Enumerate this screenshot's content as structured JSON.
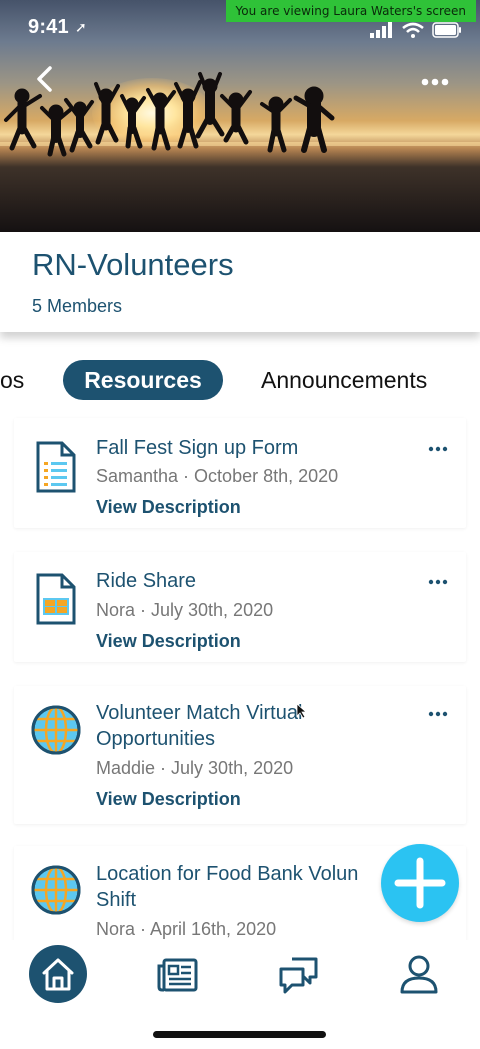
{
  "status_bar": {
    "time": "9:41",
    "share_banner": "You are viewing Laura Waters's screen"
  },
  "header": {
    "back_icon": "chevron-left-icon",
    "more_icon": "more-horizontal-icon"
  },
  "group": {
    "title": "RN-Volunteers",
    "members": "5 Members"
  },
  "tabs": {
    "left_partial": "os",
    "active": "Resources",
    "right": "Announcements"
  },
  "resources": [
    {
      "title": "Fall Fest Sign up Form",
      "meta": "Samantha · October 8th, 2020",
      "link": "View Description",
      "icon": "document-list-icon"
    },
    {
      "title": "Ride Share",
      "meta": "Nora · July 30th, 2020",
      "link": "View Description",
      "icon": "spreadsheet-icon"
    },
    {
      "title": "Volunteer Match Virtual Opportunities",
      "meta": "Maddie · July 30th, 2020",
      "link": "View Description",
      "icon": "globe-icon"
    },
    {
      "title": "Location for Food Bank Volun Shift",
      "meta": "Nora · April 16th, 2020",
      "link": "",
      "icon": "globe-icon"
    }
  ],
  "fab": {
    "icon": "plus-icon"
  },
  "bottom_nav": [
    {
      "name": "home",
      "icon": "home-icon"
    },
    {
      "name": "news",
      "icon": "newspaper-icon"
    },
    {
      "name": "messages",
      "icon": "chat-bubbles-icon"
    },
    {
      "name": "profile",
      "icon": "person-icon"
    }
  ],
  "colors": {
    "primary": "#1d5270",
    "accent": "#2bc3f2",
    "banner_green": "#2fc238",
    "icon_orange": "#f5a623",
    "icon_light_blue": "#5cc8f0"
  }
}
